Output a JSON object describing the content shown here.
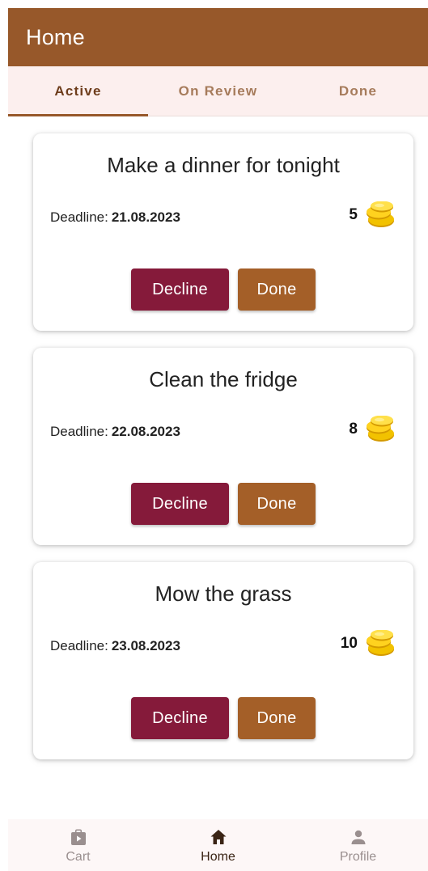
{
  "header": {
    "title": "Home"
  },
  "tabs": [
    {
      "label": "Active",
      "active": true
    },
    {
      "label": "On Review",
      "active": false
    },
    {
      "label": "Done",
      "active": false
    }
  ],
  "tasks": [
    {
      "title": "Make a dinner for tonight",
      "deadline_label": "Deadline:",
      "deadline": "21.08.2023",
      "reward": "5",
      "decline_label": "Decline",
      "done_label": "Done"
    },
    {
      "title": "Clean the fridge",
      "deadline_label": "Deadline:",
      "deadline": "22.08.2023",
      "reward": "8",
      "decline_label": "Decline",
      "done_label": "Done"
    },
    {
      "title": "Mow the grass",
      "deadline_label": "Deadline:",
      "deadline": "23.08.2023",
      "reward": "10",
      "decline_label": "Decline",
      "done_label": "Done"
    }
  ],
  "bottom_nav": [
    {
      "label": "Cart",
      "icon": "cart-icon",
      "active": false
    },
    {
      "label": "Home",
      "icon": "home-icon",
      "active": true
    },
    {
      "label": "Profile",
      "icon": "profile-icon",
      "active": false
    }
  ],
  "colors": {
    "primary": "#97582a",
    "decline": "#851a3a",
    "done": "#a45f28",
    "tab_background": "#fcefee",
    "coin": "#f2c200"
  }
}
